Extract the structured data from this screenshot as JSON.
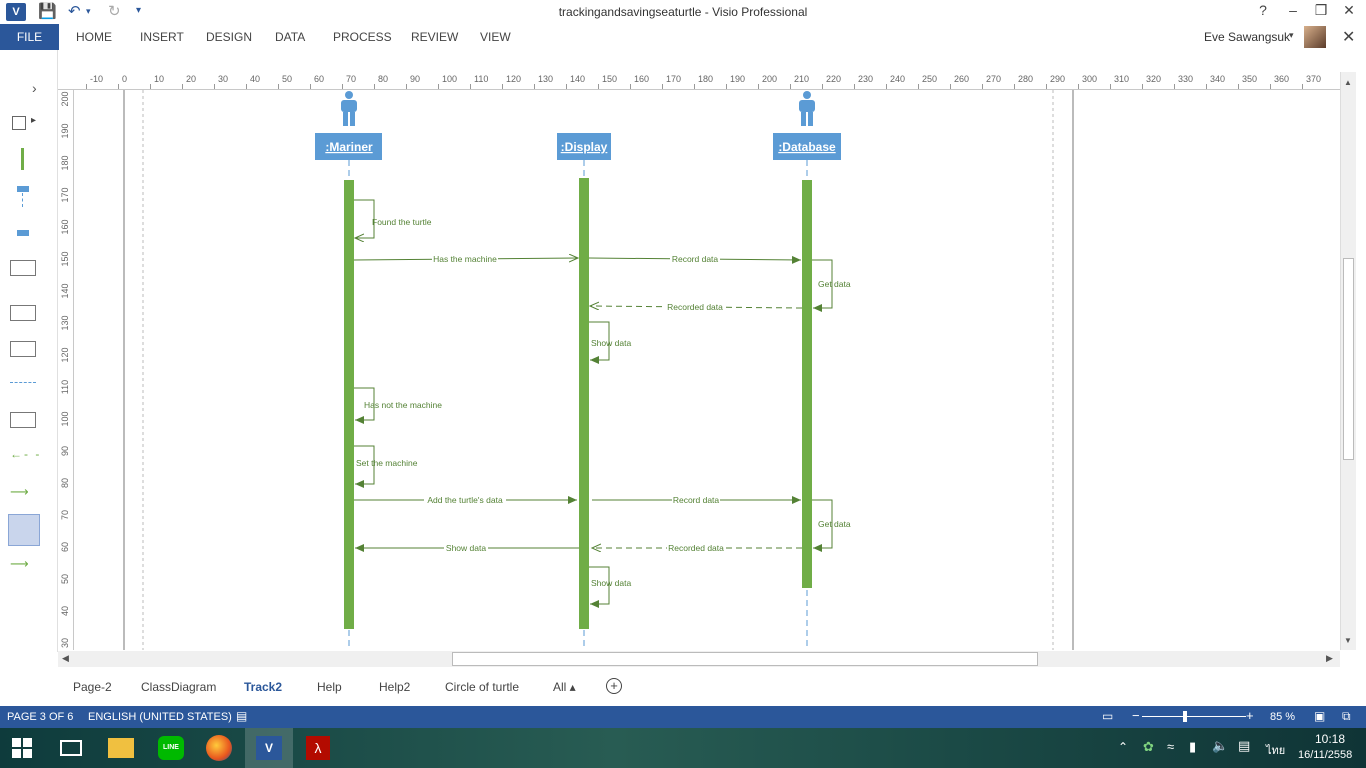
{
  "window": {
    "title": "trackingandsavingseaturtle - Visio Professional",
    "app_icon": "V",
    "controls": [
      "?",
      "–",
      "❒",
      "✕"
    ]
  },
  "ribbon": {
    "file": "FILE",
    "tabs": [
      "HOME",
      "INSERT",
      "DESIGN",
      "DATA",
      "PROCESS",
      "REVIEW",
      "VIEW"
    ],
    "user": "Eve Sawangsuk"
  },
  "ruler": {
    "h_ticks": [
      "-10",
      "0",
      "10",
      "20",
      "30",
      "40",
      "50",
      "60",
      "70",
      "80",
      "90",
      "100",
      "110",
      "120",
      "130",
      "140",
      "150",
      "160",
      "170",
      "180",
      "190",
      "200",
      "210",
      "220",
      "230",
      "240",
      "250",
      "260",
      "270",
      "280",
      "290",
      "300",
      "310",
      "320",
      "330",
      "340",
      "350",
      "360",
      "370"
    ],
    "v_ticks": [
      "200",
      "190",
      "180",
      "170",
      "160",
      "150",
      "140",
      "130",
      "120",
      "110",
      "100",
      "90",
      "80",
      "70",
      "60",
      "50",
      "40",
      "30"
    ]
  },
  "diagram": {
    "lifelines": [
      ":Mariner",
      ":Display",
      ":Database"
    ],
    "messages": {
      "found_turtle": "Found the turtle",
      "has_machine": "Has the machine",
      "record_data_1": "Record data",
      "get_data_1": "Get data",
      "recorded_data_1": "Recorded data",
      "show_data_1": "Show data",
      "has_not_machine": "Has not the machine",
      "set_machine": "Set the machine",
      "add_turtle_data": "Add the turtle's data",
      "record_data_2": "Record data",
      "get_data_2": "Get data",
      "show_data_2": "Show data",
      "recorded_data_2": "Recorded data",
      "show_data_3": "Show data"
    }
  },
  "page_tabs": {
    "tabs": [
      "Page-2",
      "ClassDiagram",
      "Track2",
      "Help",
      "Help2",
      "Circle of turtle",
      "All ▴"
    ],
    "active": "Track2"
  },
  "status": {
    "page": "PAGE 3 OF 6",
    "language": "ENGLISH (UNITED STATES)",
    "zoom": "85 %"
  },
  "taskbar": {
    "time": "10:18",
    "date": "16/11/2558",
    "ime": "ไทย"
  },
  "colors": {
    "accent": "#2b579a",
    "lifeline_header": "#5b9bd5",
    "activation": "#70ad47",
    "message": "#548235"
  }
}
